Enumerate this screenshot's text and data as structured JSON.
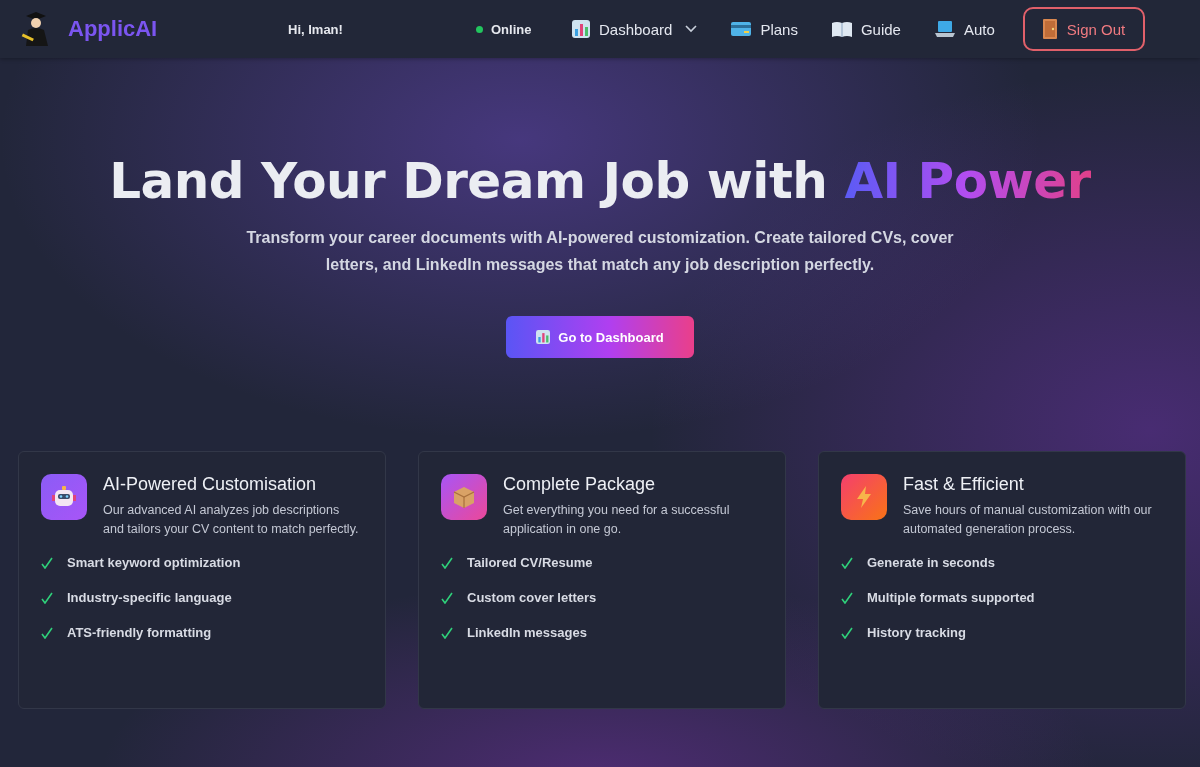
{
  "header": {
    "brand": "ApplicAI",
    "greeting": "Hi, Iman!",
    "status": {
      "label": "Online",
      "online": true
    },
    "nav": [
      {
        "label": "Dashboard",
        "has_menu": true
      },
      {
        "label": "Plans",
        "has_menu": false
      },
      {
        "label": "Guide",
        "has_menu": false
      },
      {
        "label": "Auto",
        "has_menu": false
      }
    ],
    "sign_out": "Sign Out"
  },
  "hero": {
    "title": "Land Your Dream Job with",
    "highlight": "AI Power",
    "subtitle": "Transform your career documents with AI-powered customization. Create tailored CVs, cover letters, and LinkedIn messages that match any job description perfectly.",
    "cta": "Go to Dashboard"
  },
  "features": [
    {
      "title": "AI-Powered Customisation",
      "description": "Our advanced AI analyzes job descriptions and tailors your CV content to match perfectly.",
      "points": [
        "Smart keyword optimization",
        "Industry-specific language",
        "ATS-friendly formatting"
      ]
    },
    {
      "title": "Complete Package",
      "description": "Get everything you need for a successful application in one go.",
      "points": [
        "Tailored CV/Resume",
        "Custom cover letters",
        "LinkedIn messages"
      ]
    },
    {
      "title": "Fast & Efficient",
      "description": "Save hours of manual customization with our automated generation process.",
      "points": [
        "Generate in seconds",
        "Multiple formats supported",
        "History tracking"
      ]
    }
  ]
}
